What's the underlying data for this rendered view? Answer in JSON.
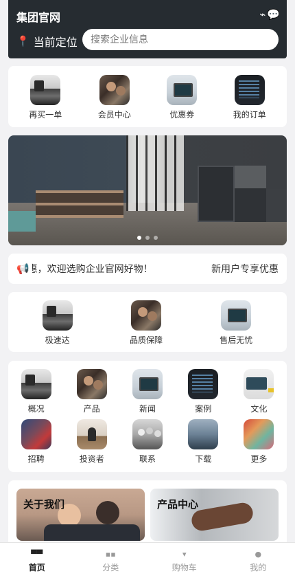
{
  "header": {
    "brand": "集团官网",
    "location_label": "当前定位",
    "search_placeholder": "搜索企业信息"
  },
  "quick_links": [
    {
      "label": "再买一单",
      "icon": "office-desk-icon"
    },
    {
      "label": "会员中心",
      "icon": "team-photo-icon"
    },
    {
      "label": "优惠券",
      "icon": "laptop-photo-icon"
    },
    {
      "label": "我的订单",
      "icon": "code-screen-icon"
    }
  ],
  "banner": {
    "slides": 3,
    "active_slide": 1
  },
  "notice": {
    "text": "专享优惠，欢迎选购企业官网好物！",
    "right_text": "新用户专享优惠"
  },
  "services": [
    {
      "label": "极速达"
    },
    {
      "label": "品质保障"
    },
    {
      "label": "售后无忧"
    }
  ],
  "categories": [
    {
      "label": "概况"
    },
    {
      "label": "产品"
    },
    {
      "label": "新闻"
    },
    {
      "label": "案例"
    },
    {
      "label": "文化"
    },
    {
      "label": "招聘"
    },
    {
      "label": "投资者"
    },
    {
      "label": "联系"
    },
    {
      "label": "下载"
    },
    {
      "label": "更多"
    }
  ],
  "promos": [
    {
      "title": "关于我们"
    },
    {
      "title": "产品中心"
    }
  ],
  "tabbar": [
    {
      "label": "首页",
      "active": true
    },
    {
      "label": "分类",
      "active": false
    },
    {
      "label": "购物车",
      "active": false
    },
    {
      "label": "我的",
      "active": false
    }
  ],
  "colors": {
    "header_bg": "#262c31",
    "pin": "#e5483a",
    "page_bg": "#f2f2f4"
  }
}
